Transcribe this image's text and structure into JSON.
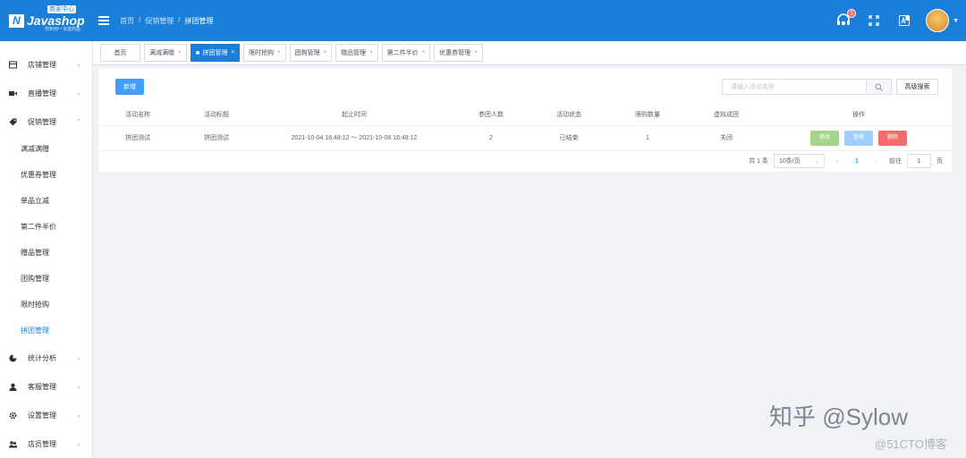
{
  "logo": {
    "name": "Javashop",
    "badge": "商家中心",
    "tagline": "你到用一本建商品"
  },
  "breadcrumb": {
    "home": "首页",
    "sep1": "/",
    "section": "促销管理",
    "sep2": "/",
    "current": "拼团管理"
  },
  "header": {
    "notification_count": "3"
  },
  "sidebar": {
    "items": [
      {
        "label": "店铺管理",
        "icon": "shop-icon"
      },
      {
        "label": "直播管理",
        "icon": "video-icon"
      },
      {
        "label": "促销管理",
        "icon": "tag-icon"
      }
    ],
    "promo_sub": [
      "满减满赠",
      "优惠券管理",
      "单品立减",
      "第二件半价",
      "赠品管理",
      "团购管理",
      "限时抢购",
      "拼团管理"
    ],
    "items_after": [
      {
        "label": "统计分析",
        "icon": "pie-chart-icon"
      },
      {
        "label": "客服管理",
        "icon": "user-icon"
      },
      {
        "label": "设置管理",
        "icon": "gear-icon"
      },
      {
        "label": "店员管理",
        "icon": "users-icon"
      }
    ]
  },
  "tabs": [
    {
      "label": "首页"
    },
    {
      "label": "满减满赠"
    },
    {
      "label": "拼团管理"
    },
    {
      "label": "限时抢购"
    },
    {
      "label": "团购管理"
    },
    {
      "label": "赠品管理"
    },
    {
      "label": "第二件半价"
    },
    {
      "label": "优惠券管理"
    }
  ],
  "tab_close": "×",
  "toolbar": {
    "add_label": "新增",
    "search_placeholder": "请输入活动名称",
    "advanced_label": "高级搜索"
  },
  "table": {
    "headers": [
      "活动名称",
      "活动标题",
      "起止时间",
      "参团人数",
      "活动状态",
      "限购数量",
      "虚拟成团",
      "操作"
    ],
    "rows": [
      [
        "拼团测试",
        "拼团测试",
        "2021-10-04 16:48:12 ～ 2021-10-08 16:48:12",
        "2",
        "已结束",
        "1",
        "关闭"
      ]
    ],
    "actions": {
      "edit": "修改",
      "manage": "管理",
      "delete": "删除"
    }
  },
  "pagination": {
    "total": "共 1 条",
    "page_size": "10条/页",
    "current": "1",
    "goto": "前往",
    "goto_value": "1",
    "page_unit": "页"
  },
  "watermark": {
    "main": "知乎 @Sylow",
    "sub": "@51CTO博客"
  },
  "colors": {
    "primary": "#1a7fd9",
    "accent": "#409eff",
    "danger": "#f56c6c",
    "success_light": "#a3d68a"
  }
}
